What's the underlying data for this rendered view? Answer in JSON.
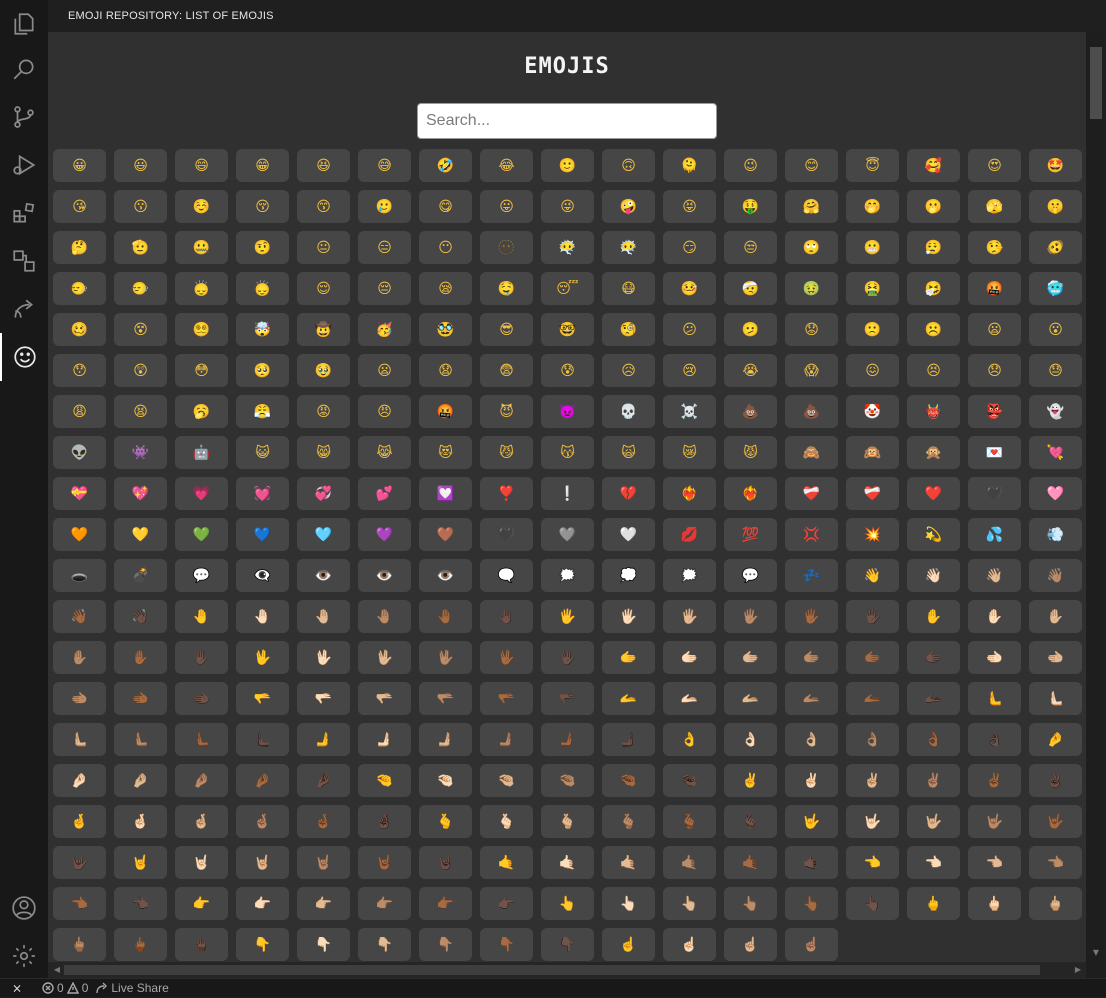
{
  "panel": {
    "title": "EMOJI REPOSITORY: LIST OF EMOJIS"
  },
  "page": {
    "heading": "EMOJIS"
  },
  "search": {
    "placeholder": "Search..."
  },
  "activity_bar": {
    "items": [
      {
        "icon": "files-icon",
        "active": false
      },
      {
        "icon": "search-icon",
        "active": false
      },
      {
        "icon": "source-control-icon",
        "active": false
      },
      {
        "icon": "run-debug-icon",
        "active": false
      },
      {
        "icon": "extensions-icon",
        "active": false
      },
      {
        "icon": "remote-explorer-icon",
        "active": false
      },
      {
        "icon": "live-share-icon",
        "active": false
      },
      {
        "icon": "emoji-icon",
        "active": true
      }
    ],
    "bottom": [
      {
        "icon": "account-icon"
      },
      {
        "icon": "settings-gear-icon"
      }
    ]
  },
  "status_bar": {
    "errors": "0",
    "warnings": "0",
    "live_share": "Live Share"
  },
  "emojis": [
    "😀",
    "😃",
    "😄",
    "😁",
    "😆",
    "😅",
    "🤣",
    "😂",
    "🙂",
    "🙃",
    "🫠",
    "😉",
    "😊",
    "😇",
    "🥰",
    "😍",
    "🤩",
    "😘",
    "😗",
    "☺️",
    "😚",
    "😙",
    "🥲",
    "😋",
    "😛",
    "😜",
    "🤪",
    "😝",
    "🤑",
    "🤗",
    "🤭",
    "🫢",
    "🫣",
    "🤫",
    "🤔",
    "🫡",
    "🤐",
    "🤨",
    "😐",
    "😑",
    "😶",
    "🫥",
    "😶‍🌫️",
    "😶‍🌫️",
    "😏",
    "😒",
    "🙄",
    "😬",
    "😮‍💨",
    "🤥",
    "🫨",
    "🙂‍↔️",
    "🙂‍↔️",
    "🙂‍↕️",
    "🙂‍↕️",
    "😌",
    "😔",
    "😪",
    "🤤",
    "😴",
    "😷",
    "🤒",
    "🤕",
    "🤢",
    "🤮",
    "🤧",
    "🤬",
    "🥶",
    "🥴",
    "😵",
    "😵‍💫",
    "🤯",
    "🤠",
    "🥳",
    "🥸",
    "😎",
    "🤓",
    "🧐",
    "😕",
    "🫤",
    "😟",
    "🙁",
    "☹️",
    "😦",
    "😮",
    "😯",
    "😲",
    "😳",
    "🥺",
    "🥹",
    "😦",
    "😧",
    "😨",
    "😰",
    "😥",
    "😢",
    "😭",
    "😱",
    "😖",
    "😣",
    "😞",
    "😓",
    "😩",
    "😫",
    "🥱",
    "😤",
    "😡",
    "😠",
    "🤬",
    "😈",
    "👿",
    "💀",
    "☠️",
    "💩",
    "💩",
    "🤡",
    "👹",
    "👺",
    "👻",
    "👽",
    "👾",
    "🤖",
    "😺",
    "😸",
    "😹",
    "😻",
    "😼",
    "😽",
    "🙀",
    "😿",
    "😾",
    "🙈",
    "🙉",
    "🙊",
    "💌",
    "💘",
    "💝",
    "💖",
    "💗",
    "💓",
    "💞",
    "💕",
    "💟",
    "❣️",
    "❕",
    "💔",
    "❤️‍🔥",
    "❤️‍🔥",
    "❤️‍🩹",
    "❤️‍🩹",
    "❤️",
    "🖤",
    "🩷",
    "🧡",
    "💛",
    "💚",
    "💙",
    "🩵",
    "💜",
    "🤎",
    "🖤",
    "🩶",
    "🤍",
    "💋",
    "💯",
    "💢",
    "💥",
    "💫",
    "💦",
    "💨",
    "🕳️",
    "💣",
    "💬",
    "👁️‍🗨️",
    "👁️",
    "👁️",
    "👁️",
    "🗨️",
    "🗯️",
    "💭",
    "🗯️",
    "💬",
    "💤",
    "👋",
    "👋🏻",
    "👋🏼",
    "👋🏽",
    "👋🏾",
    "👋🏿",
    "🤚",
    "🤚🏻",
    "🤚🏼",
    "🤚🏽",
    "🤚🏾",
    "🤚🏿",
    "🖐️",
    "🖐🏻",
    "🖐🏼",
    "🖐🏽",
    "🖐🏾",
    "🖐🏿",
    "✋",
    "✋🏻",
    "✋🏼",
    "✋🏽",
    "✋🏾",
    "✋🏿",
    "🖖",
    "🖖🏻",
    "🖖🏼",
    "🖖🏽",
    "🖖🏾",
    "🖖🏿",
    "🫱",
    "🫱🏻",
    "🫱🏼",
    "🫱🏽",
    "🫱🏾",
    "🫱🏿",
    "🫲🏻",
    "🫲🏼",
    "🫲🏽",
    "🫲🏾",
    "🫲🏿",
    "🫳",
    "🫳🏻",
    "🫳🏼",
    "🫳🏽",
    "🫳🏾",
    "🫳🏿",
    "🫴",
    "🫴🏻",
    "🫴🏼",
    "🫴🏽",
    "🫴🏾",
    "🫴🏿",
    "🫷",
    "🫷🏻",
    "🫷🏼",
    "🫷🏽",
    "🫷🏾",
    "🫷🏿",
    "🫸",
    "🫸🏻",
    "🫸🏼",
    "🫸🏽",
    "🫸🏾",
    "🫸🏿",
    "👌",
    "👌🏻",
    "👌🏼",
    "👌🏽",
    "👌🏾",
    "👌🏿",
    "🤌",
    "🤌🏻",
    "🤌🏼",
    "🤌🏽",
    "🤌🏾",
    "🤌🏿",
    "🤏",
    "🤏🏻",
    "🤏🏼",
    "🤏🏽",
    "🤏🏾",
    "🤏🏿",
    "✌️",
    "✌🏻",
    "✌🏼",
    "✌🏽",
    "✌🏾",
    "✌🏿",
    "🤞",
    "🤞🏻",
    "🤞🏼",
    "🤞🏽",
    "🤞🏾",
    "🤞🏿",
    "🫰",
    "🫰🏻",
    "🫰🏼",
    "🫰🏽",
    "🫰🏾",
    "🫰🏿",
    "🤟",
    "🤟🏻",
    "🤟🏼",
    "🤟🏽",
    "🤟🏾",
    "🤟🏿",
    "🤘",
    "🤘🏻",
    "🤘🏼",
    "🤘🏽",
    "🤘🏾",
    "🤘🏿",
    "🤙",
    "🤙🏻",
    "🤙🏼",
    "🤙🏽",
    "🤙🏾",
    "🤙🏿",
    "👈",
    "👈🏻",
    "👈🏼",
    "👈🏽",
    "👈🏾",
    "👈🏿",
    "👉",
    "👉🏻",
    "👉🏼",
    "👉🏽",
    "👉🏾",
    "👉🏿",
    "👆",
    "👆🏻",
    "👆🏼",
    "👆🏽",
    "👆🏾",
    "👆🏿",
    "🖕",
    "🖕🏻",
    "🖕🏼",
    "🖕🏽",
    "🖕🏾",
    "🖕🏿",
    "👇",
    "👇🏻",
    "👇🏼",
    "👇🏽",
    "👇🏾",
    "👇🏿",
    "☝️",
    "☝🏻",
    "☝🏼",
    "☝🏽"
  ]
}
